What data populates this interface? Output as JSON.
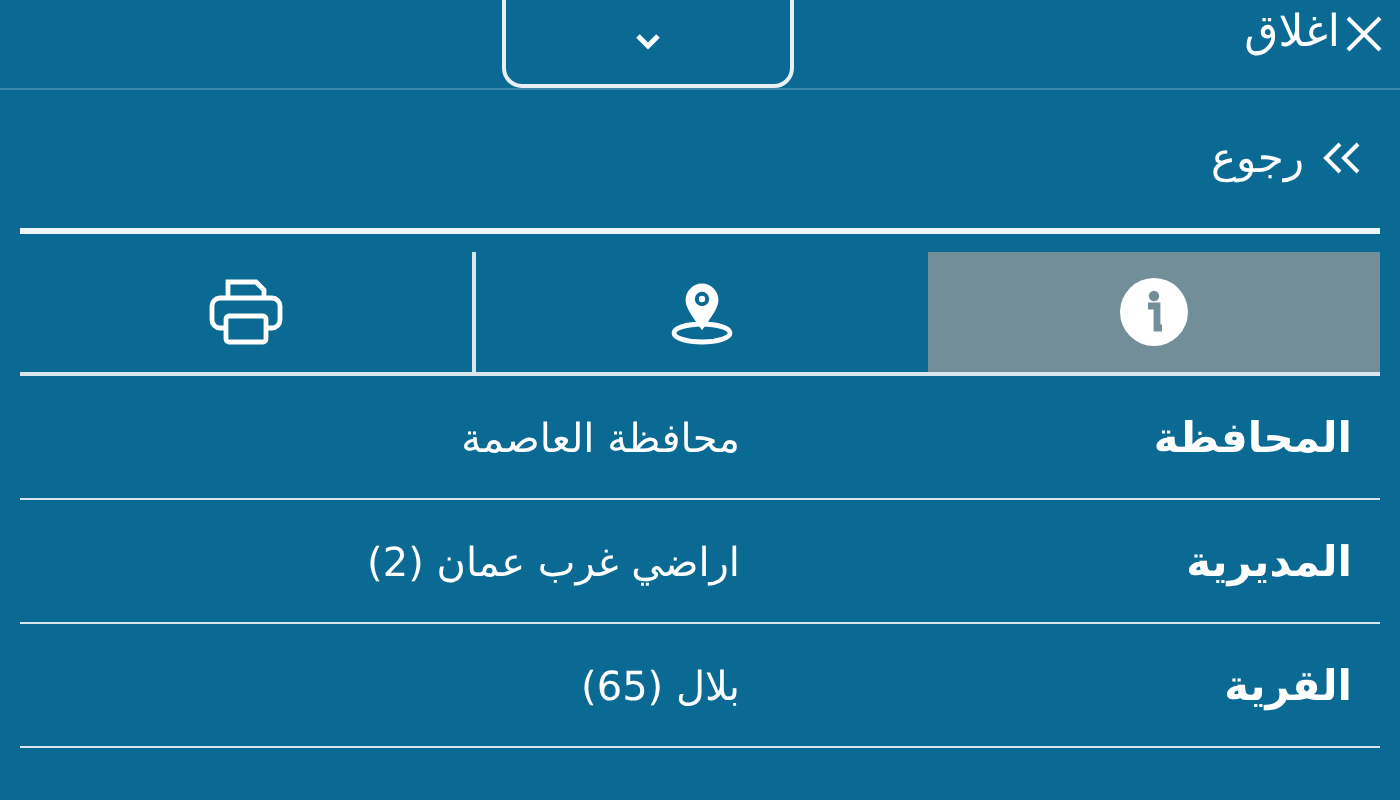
{
  "header": {
    "close_label": "اغلاق"
  },
  "back": {
    "label": "رجوع"
  },
  "tabs": [
    {
      "kind": "info",
      "selected": true
    },
    {
      "kind": "location",
      "selected": false
    },
    {
      "kind": "print",
      "selected": false
    }
  ],
  "details": [
    {
      "label": "المحافظة",
      "value": "محافظة العاصمة"
    },
    {
      "label": "المديرية",
      "value": "اراضي غرب عمان (2)"
    },
    {
      "label": "القرية",
      "value": "بلال (65)"
    }
  ]
}
